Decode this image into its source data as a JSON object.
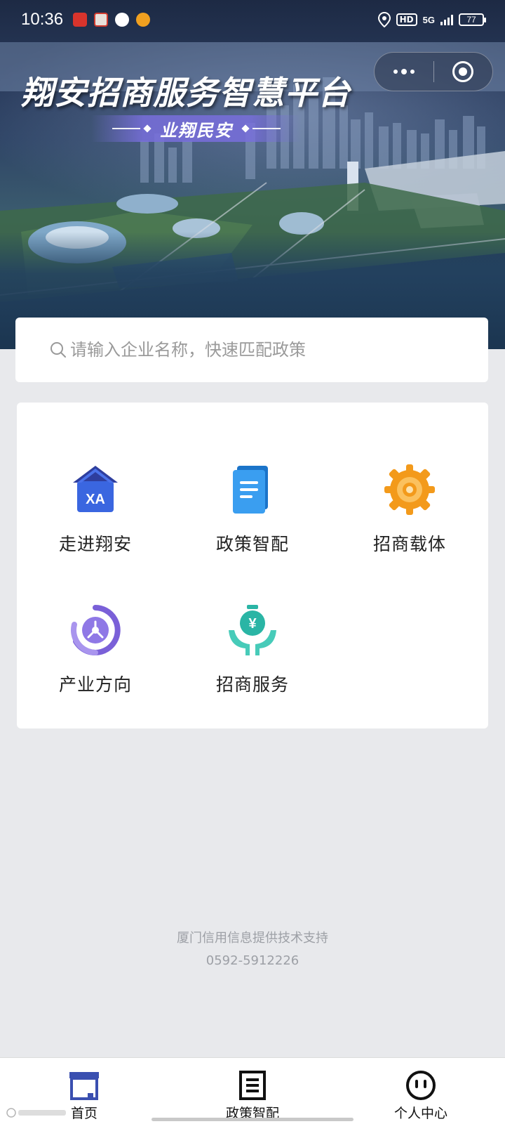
{
  "status_bar": {
    "time": "10:36",
    "hd_label": "HD",
    "network_label": "5G",
    "battery": "77"
  },
  "banner": {
    "title": "翔安招商服务智慧平台",
    "slogan": "业翔民安"
  },
  "search": {
    "placeholder": "请输入企业名称，快速匹配政策"
  },
  "menu": {
    "items": [
      {
        "label": "走进翔安",
        "icon": "xa-house-icon",
        "color": "#3a5bd9"
      },
      {
        "label": "政策智配",
        "icon": "document-icon",
        "color": "#2f8fe0"
      },
      {
        "label": "招商载体",
        "icon": "gear-icon",
        "color": "#f5a623"
      },
      {
        "label": "产业方向",
        "icon": "compass-icon",
        "color": "#8b6fe0"
      },
      {
        "label": "招商服务",
        "icon": "money-hands-icon",
        "color": "#2ab5a5"
      }
    ]
  },
  "footer": {
    "credit": "厦门信用信息提供技术支持",
    "phone": "0592-5912226"
  },
  "bottom_nav": {
    "items": [
      {
        "label": "首页",
        "icon": "home-box-icon"
      },
      {
        "label": "政策智配",
        "icon": "list-doc-icon"
      },
      {
        "label": "个人中心",
        "icon": "face-icon"
      }
    ]
  },
  "colors": {
    "background": "#e8e9ec",
    "accent_blue": "#3a4fb0",
    "text_gray": "#9da0a6"
  }
}
